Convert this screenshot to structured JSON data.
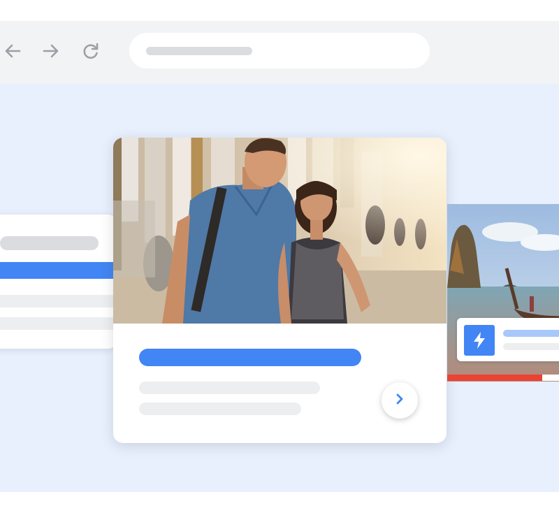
{
  "browser": {
    "back_icon": "arrow-left-icon",
    "forward_icon": "arrow-right-icon",
    "reload_icon": "reload-icon",
    "address_bar": {
      "text": ""
    }
  },
  "main_card": {
    "photo": "couple-at-temple-photo",
    "next_icon": "chevron-right-icon"
  },
  "right_card": {
    "photo": "longtail-boat-cliff-photo",
    "badge_icon": "lightning-bolt-icon",
    "progress": 0.8
  },
  "colors": {
    "accent_blue": "#4285f4",
    "placeholder_gray": "#e8eaed",
    "stage_background": "#e8f0fe",
    "progress_red": "#ea4335"
  }
}
